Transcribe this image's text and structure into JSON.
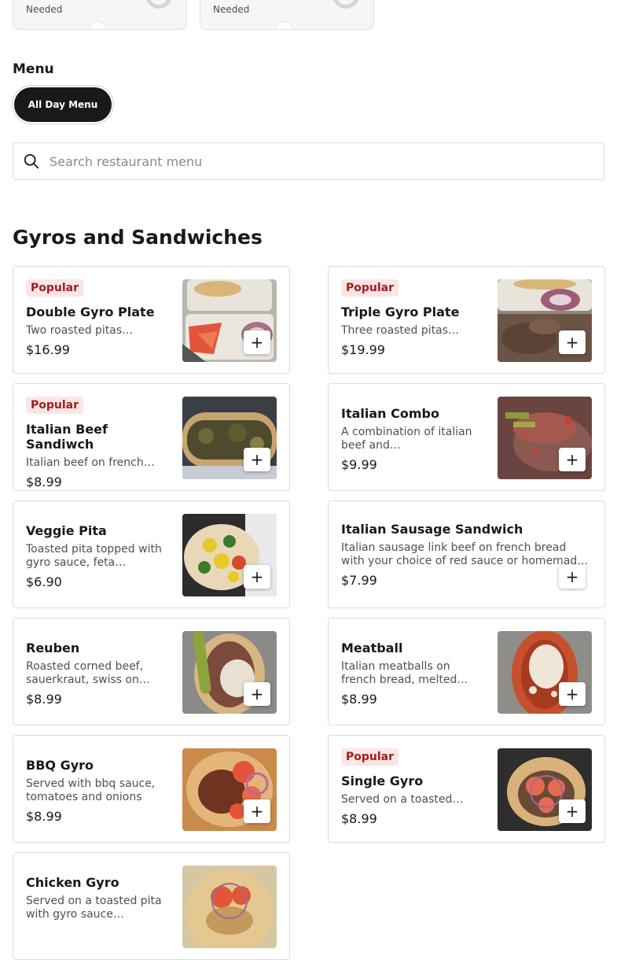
{
  "top_cards": [
    {
      "label": "Needed"
    },
    {
      "label": "Needed"
    }
  ],
  "menu": {
    "heading": "Menu",
    "tabs": [
      {
        "label": "All Day Menu",
        "selected": true
      }
    ]
  },
  "search": {
    "placeholder": "Search restaurant menu"
  },
  "section": {
    "title": "Gyros and Sandwiches",
    "items": [
      {
        "badge": "Popular",
        "name": "Double Gyro Plate",
        "desc": "Two roasted pitas…",
        "price": "$16.99",
        "image": "gyro-plate-photo"
      },
      {
        "badge": "Popular",
        "name": "Triple Gyro Plate",
        "desc": "Three roasted pitas…",
        "price": "$19.99",
        "image": "gyro-plate-photo"
      },
      {
        "badge": "Popular",
        "name": "Italian Beef Sandiwch",
        "desc": "Italian beef on french…",
        "price": "$8.99",
        "image": "italian-beef-photo"
      },
      {
        "badge": "",
        "name": "Italian Combo",
        "desc": "A combination of italian beef and…",
        "price": "$9.99",
        "image": "italian-combo-photo"
      },
      {
        "badge": "",
        "name": "Veggie Pita",
        "desc": "Toasted pita topped with gyro sauce, feta…",
        "price": "$6.90",
        "image": "veggie-pita-photo"
      },
      {
        "badge": "",
        "name": "Italian Sausage Sandwich",
        "desc": "Italian sausage link beef on french bread with your choice of red sauce or homemad…",
        "price": "$7.99",
        "image": ""
      },
      {
        "badge": "",
        "name": "Reuben",
        "desc": "Roasted corned beef, sauerkraut, swiss on…",
        "price": "$8.99",
        "image": "reuben-photo"
      },
      {
        "badge": "",
        "name": "Meatball",
        "desc": "Italian meatballs on french bread, melted…",
        "price": "$8.99",
        "image": "meatball-photo"
      },
      {
        "badge": "",
        "name": "BBQ Gyro",
        "desc": "Served with bbq sauce, tomatoes and onions",
        "price": "$8.99",
        "image": "bbq-gyro-photo"
      },
      {
        "badge": "Popular",
        "name": "Single Gyro",
        "desc": "Served on a toasted…",
        "price": "$8.99",
        "image": "single-gyro-photo"
      },
      {
        "badge": "",
        "name": "Chicken Gyro",
        "desc": "Served on a toasted pita with gyro sauce…",
        "price": "",
        "image": "chicken-gyro-photo"
      }
    ]
  },
  "add_button": {
    "label": "+",
    "icon": "plus-icon"
  },
  "colors": {
    "accent": "#191919",
    "badge_bg": "#fce5e5",
    "badge_text": "#a01e1e"
  }
}
